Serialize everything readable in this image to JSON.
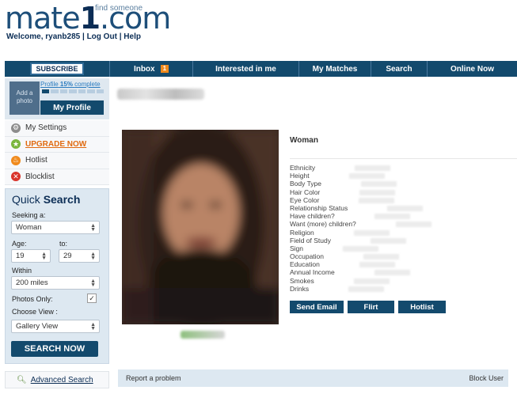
{
  "header": {
    "logo_prefix": "mate",
    "logo_number": "1",
    "logo_suffix": ".com",
    "tagline": "find someone",
    "welcome": "Welcome, ryanb285",
    "sep1": "|",
    "logout": "Log Out",
    "sep2": "|",
    "help": "Help"
  },
  "nav": {
    "subscribe": "SUBSCRIBE",
    "inbox": "Inbox",
    "inbox_count": "1",
    "interested": "Interested in me",
    "matches": "My Matches",
    "search": "Search",
    "online": "Online Now"
  },
  "profile_box": {
    "add_photo": "Add a photo",
    "complete_prefix": "Profile",
    "complete_pct": "15%",
    "complete_suffix": "complete",
    "progress": 0.15,
    "my_profile": "My Profile"
  },
  "menu": {
    "settings": "My Settings",
    "upgrade": "UPGRADE NOW",
    "hotlist": "Hotlist",
    "blocklist": "Blocklist"
  },
  "quick_search": {
    "title_a": "Quick",
    "title_b": "Search",
    "seeking_label": "Seeking a:",
    "seeking_value": "Woman",
    "age_label": "Age:",
    "to_label": "to:",
    "age_from": "19",
    "age_to": "29",
    "within_label": "Within",
    "within_value": "200 miles",
    "photos_label": "Photos Only:",
    "photos_checked": true,
    "view_label": "Choose View :",
    "view_value": "Gallery View",
    "search_button": "SEARCH NOW"
  },
  "advanced": "Advanced Search",
  "profile": {
    "gender": "Woman",
    "attributes": [
      "Ethnicity",
      "Height",
      "Body Type",
      "Hair Color",
      "Eye Color",
      "Relationship Status",
      "Have children?",
      "Want (more) children?",
      "Religion",
      "Field of Study",
      "Sign",
      "Occupation",
      "Education",
      "Annual Income",
      "Smokes",
      "Drinks"
    ],
    "send_email": "Send Email",
    "flirt": "Flirt",
    "hotlist": "Hotlist"
  },
  "footer": {
    "report": "Report a problem",
    "block": "Block User"
  },
  "colors": {
    "brand_navy": "#134a6d",
    "accent_orange": "#f08a1c",
    "panel_blue": "#dde8f1"
  }
}
